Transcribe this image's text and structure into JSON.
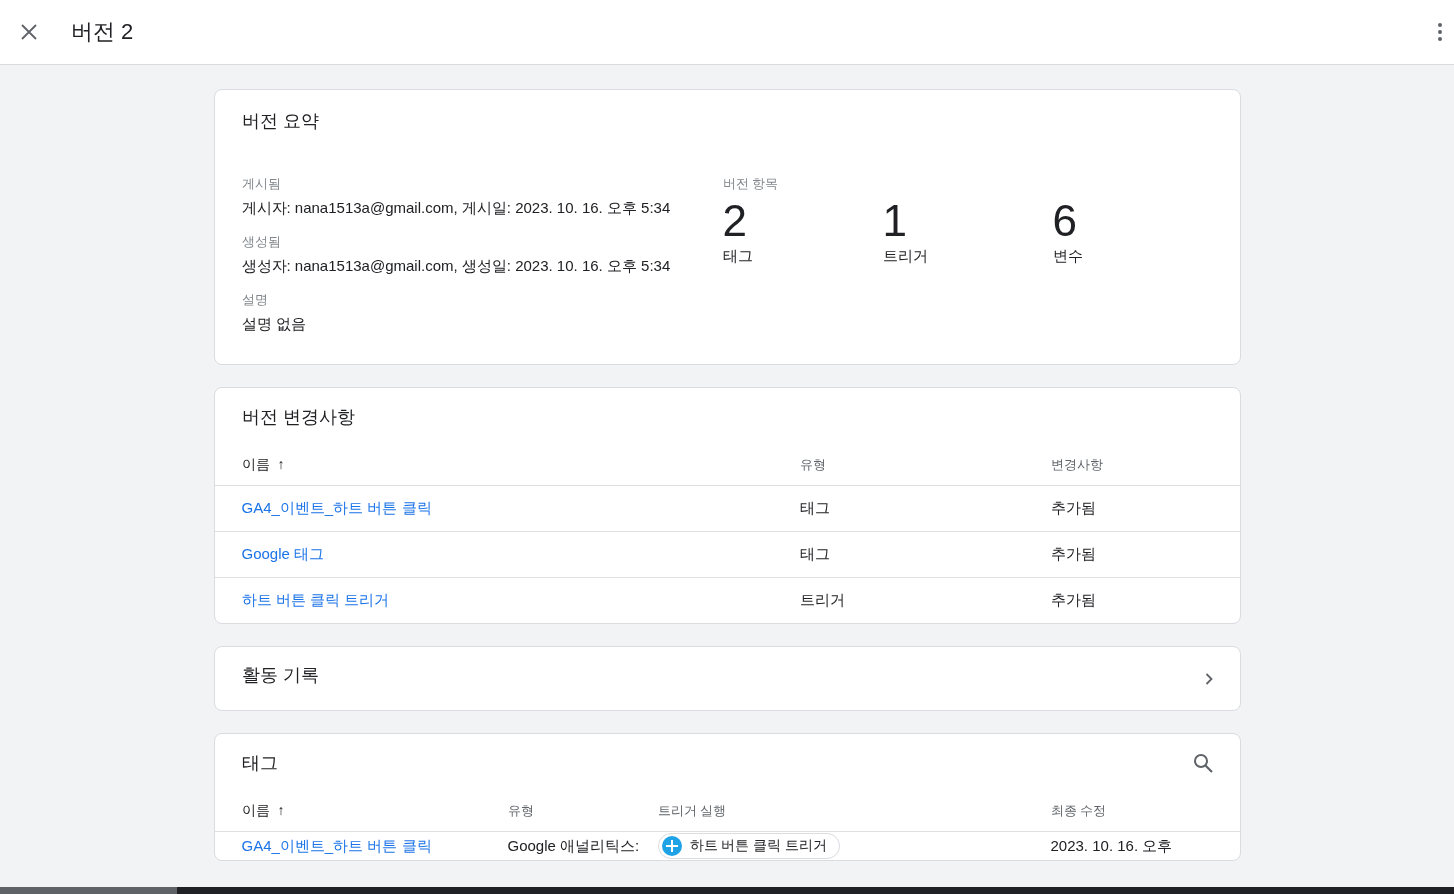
{
  "header": {
    "title": "버전 2"
  },
  "summary": {
    "title": "버전 요약",
    "fields": [
      {
        "label": "게시됨",
        "value": "게시자: nana1513a@gmail.com, 게시일: 2023. 10. 16. 오후 5:34"
      },
      {
        "label": "생성됨",
        "value": "생성자: nana1513a@gmail.com, 생성일: 2023. 10. 16. 오후 5:34"
      },
      {
        "label": "설명",
        "value": "설명 없음"
      }
    ],
    "items_label": "버전 항목",
    "counts": [
      {
        "number": "2",
        "label": "태그"
      },
      {
        "number": "1",
        "label": "트리거"
      },
      {
        "number": "6",
        "label": "변수"
      }
    ]
  },
  "changes": {
    "title": "버전 변경사항",
    "columns": [
      "이름",
      "유형",
      "변경사항"
    ],
    "sort_arrow": "↑",
    "rows": [
      {
        "name": "GA4_이벤트_하트 버튼 클릭",
        "type": "태그",
        "change": "추가됨"
      },
      {
        "name": "Google 태그",
        "type": "태그",
        "change": "추가됨"
      },
      {
        "name": "하트 버튼 클릭 트리거",
        "type": "트리거",
        "change": "추가됨"
      }
    ]
  },
  "activity": {
    "title": "활동 기록"
  },
  "tags": {
    "title": "태그",
    "columns": [
      "이름",
      "유형",
      "트리거 실행",
      "최종 수정"
    ],
    "sort_arrow": "↑",
    "rows": [
      {
        "name": "GA4_이벤트_하트 버튼 클릭",
        "type": "Google 애널리틱스:",
        "trigger": "하트 버튼 클릭 트리거",
        "modified": "2023. 10. 16. 오후"
      }
    ]
  }
}
